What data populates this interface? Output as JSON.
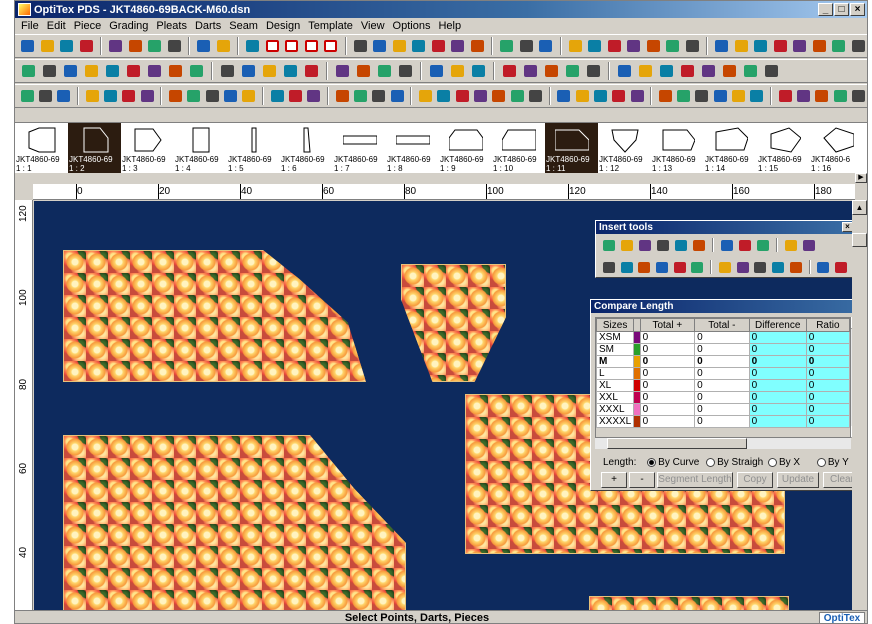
{
  "window": {
    "title": "OptiTex PDS - JKT4860-69BACK-M60.dsn",
    "buttons": [
      "_",
      "□",
      "×"
    ]
  },
  "menu": [
    "File",
    "Edit",
    "Piece",
    "Grading",
    "Pleats",
    "Darts",
    "Seam",
    "Design",
    "Template",
    "View",
    "Options",
    "Help"
  ],
  "pieces": [
    {
      "name": "JKT4860-69",
      "num": "1 : 1"
    },
    {
      "name": "JKT4860-69",
      "num": "1 : 2",
      "selected": true
    },
    {
      "name": "JKT4860-69",
      "num": "1 : 3"
    },
    {
      "name": "JKT4860-69",
      "num": "1 : 4"
    },
    {
      "name": "JKT4860-69",
      "num": "1 : 5"
    },
    {
      "name": "JKT4860-69",
      "num": "1 : 6"
    },
    {
      "name": "JKT4860-69",
      "num": "1 : 7"
    },
    {
      "name": "JKT4860-69",
      "num": "1 : 8"
    },
    {
      "name": "JKT4860-69",
      "num": "1 : 9"
    },
    {
      "name": "JKT4860-69",
      "num": "1 : 10"
    },
    {
      "name": "JKT4860-69",
      "num": "1 : 11",
      "selected": true
    },
    {
      "name": "JKT4860-69",
      "num": "1 : 12"
    },
    {
      "name": "JKT4860-69",
      "num": "1 : 13"
    },
    {
      "name": "JKT4860-69",
      "num": "1 : 14"
    },
    {
      "name": "JKT4860-69",
      "num": "1 : 15"
    },
    {
      "name": "JKT4860-6",
      "num": "1 : 16"
    }
  ],
  "ruler": {
    "h": [
      "0",
      "20",
      "40",
      "60",
      "80",
      "100",
      "120",
      "140",
      "160",
      "180"
    ],
    "v": [
      "120",
      "100",
      "80",
      "60",
      "40"
    ]
  },
  "insert_tools": {
    "title": "Insert tools"
  },
  "compare_length": {
    "title": "Compare Length",
    "columns": [
      "Sizes",
      "Total +",
      "Total -",
      "Difference",
      "Ratio"
    ],
    "rows": [
      {
        "size": "XSM",
        "color": "#7a0a7a",
        "total_plus": "0",
        "total_minus": "0",
        "difference": "0",
        "ratio": "0"
      },
      {
        "size": "SM",
        "color": "#2aa02a",
        "total_plus": "0",
        "total_minus": "0",
        "difference": "0",
        "ratio": "0"
      },
      {
        "size": "M",
        "color": "#e8a000",
        "total_plus": "0",
        "total_minus": "0",
        "difference": "0",
        "ratio": "0",
        "bold": true
      },
      {
        "size": "L",
        "color": "#e07000",
        "total_plus": "0",
        "total_minus": "0",
        "difference": "0",
        "ratio": "0"
      },
      {
        "size": "XL",
        "color": "#d00000",
        "total_plus": "0",
        "total_minus": "0",
        "difference": "0",
        "ratio": "0"
      },
      {
        "size": "XXL",
        "color": "#c00050",
        "total_plus": "0",
        "total_minus": "0",
        "difference": "0",
        "ratio": "0"
      },
      {
        "size": "XXXL",
        "color": "#f070c0",
        "total_plus": "0",
        "total_minus": "0",
        "difference": "0",
        "ratio": "0"
      },
      {
        "size": "XXXXL",
        "color": "#b03000",
        "total_plus": "0",
        "total_minus": "0",
        "difference": "0",
        "ratio": "0"
      }
    ],
    "length_label": "Length:",
    "options": [
      "By Curve",
      "By Straigh",
      "By X",
      "By Y"
    ],
    "buttons": [
      "+",
      "-",
      "Segment Length",
      "Copy",
      "Update",
      "Clear"
    ]
  },
  "status": {
    "text": "Select Points, Darts, Pieces",
    "logo": "OptiTex"
  }
}
